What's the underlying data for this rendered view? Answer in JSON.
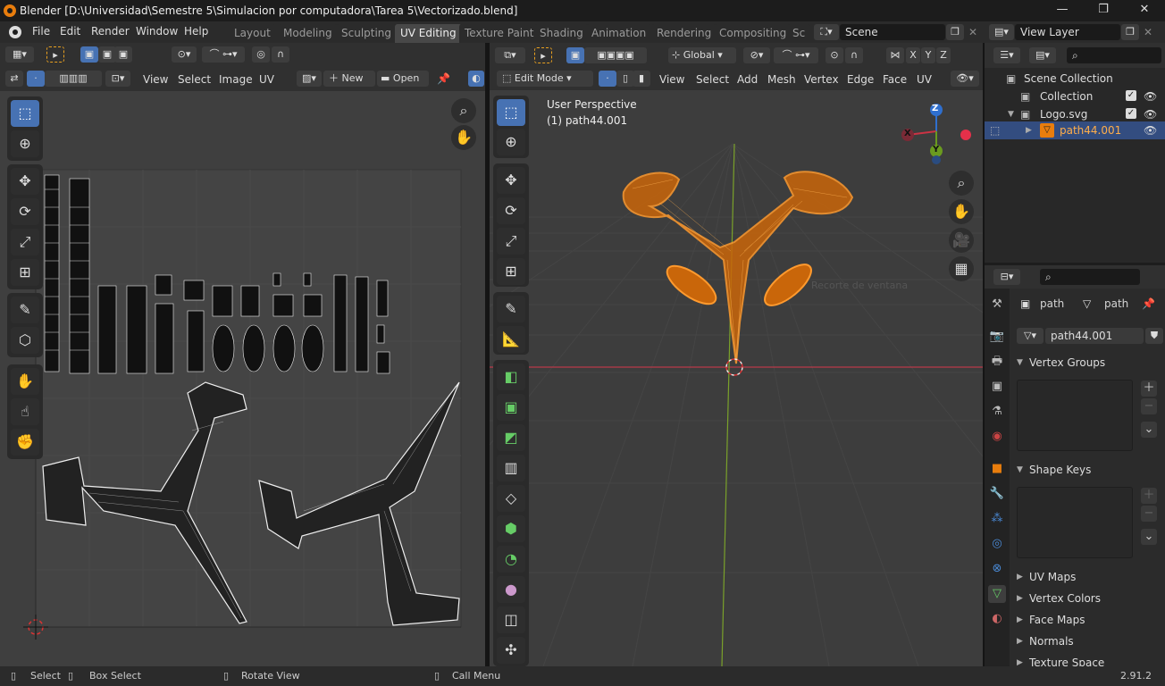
{
  "window": {
    "title": "Blender [D:\\Universidad\\Semestre 5\\Simulacion por computadora\\Tarea 5\\Vectorizado.blend]",
    "minimize": "—",
    "maximize": "❐",
    "close": "✕"
  },
  "menu": [
    "File",
    "Edit",
    "Render",
    "Window",
    "Help"
  ],
  "workspaces": [
    "Layout",
    "Modeling",
    "Sculpting",
    "UV Editing",
    "Texture Paint",
    "Shading",
    "Animation",
    "Rendering",
    "Compositing",
    "Sc"
  ],
  "active_workspace": "UV Editing",
  "scene": {
    "name": "Scene",
    "view_layer": "View Layer"
  },
  "uv_editor": {
    "menus": [
      "View",
      "Select",
      "Image",
      "UV"
    ],
    "new_label": "New",
    "open_label": "Open"
  },
  "viewport": {
    "mode": "Edit Mode",
    "orientation": "Global",
    "menus": [
      "View",
      "Select",
      "Add",
      "Mesh",
      "Vertex",
      "Edge",
      "Face",
      "UV"
    ],
    "overlay_line1": "User Perspective",
    "overlay_line2": "(1) path44.001",
    "ghost_text": "Recorte de ventana",
    "axes": {
      "x": "X",
      "y": "Y",
      "z": "Z"
    },
    "mirror_axes": [
      "X",
      "Y",
      "Z"
    ]
  },
  "outliner": {
    "root": "Scene Collection",
    "items": [
      {
        "name": "Collection"
      },
      {
        "name": "Logo.svg"
      },
      {
        "name": "path44.001",
        "active": true
      }
    ]
  },
  "properties": {
    "crumb_object": "path",
    "crumb_mesh": "path",
    "mesh_name": "path44.001",
    "panels": {
      "vertex_groups": "Vertex Groups",
      "shape_keys": "Shape Keys",
      "collapsed": [
        "UV Maps",
        "Vertex Colors",
        "Face Maps",
        "Normals",
        "Texture Space"
      ]
    }
  },
  "status": {
    "select": "Select",
    "box_select": "Box Select",
    "rotate": "Rotate View",
    "call_menu": "Call Menu",
    "version": "2.91.2"
  },
  "colors": {
    "accent": "#4772b3",
    "selection": "#e87d0d",
    "workspace_active": "#484848",
    "x_axis": "#cc3344",
    "y_axis": "#6a9a1f",
    "z_axis": "#2f6fce"
  }
}
